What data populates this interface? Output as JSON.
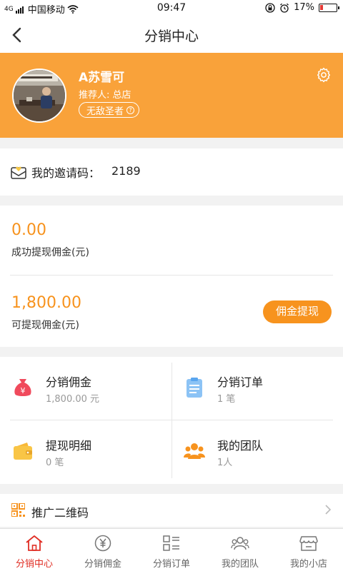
{
  "status_bar": {
    "signal_text": "4G",
    "carrier": "中国移动",
    "time": "09:47",
    "battery": "17%",
    "battery_level": 0.17
  },
  "nav": {
    "title": "分销中心"
  },
  "profile": {
    "name": "A苏雪可",
    "referrer": "推荐人: 总店",
    "badge": "无敌圣者"
  },
  "invite": {
    "label": "我的邀请码：",
    "code": "2189"
  },
  "commission": {
    "withdrawn_amount": "0.00",
    "withdrawn_label": "成功提现佣金(元)",
    "available_amount": "1,800.00",
    "available_label": "可提现佣金(元)",
    "withdraw_button": "佣金提现"
  },
  "grid": [
    {
      "title": "分销佣金",
      "sub": "1,800.00 元",
      "icon": "money-bag-icon"
    },
    {
      "title": "分销订单",
      "sub": "1 笔",
      "icon": "clipboard-icon"
    },
    {
      "title": "提现明细",
      "sub": "0 笔",
      "icon": "wallet-icon"
    },
    {
      "title": "我的团队",
      "sub": "1人",
      "icon": "team-icon"
    }
  ],
  "qr": {
    "label": "推广二维码"
  },
  "tabs": [
    {
      "label": "分销中心",
      "icon": "home-icon",
      "active": true
    },
    {
      "label": "分销佣金",
      "icon": "yen-icon",
      "active": false
    },
    {
      "label": "分销订单",
      "icon": "list-icon",
      "active": false
    },
    {
      "label": "我的团队",
      "icon": "users-icon",
      "active": false
    },
    {
      "label": "我的小店",
      "icon": "shop-icon",
      "active": false
    }
  ],
  "colors": {
    "accent": "#f9a23a",
    "amount": "#f7931e",
    "active_tab": "#e02e24"
  }
}
